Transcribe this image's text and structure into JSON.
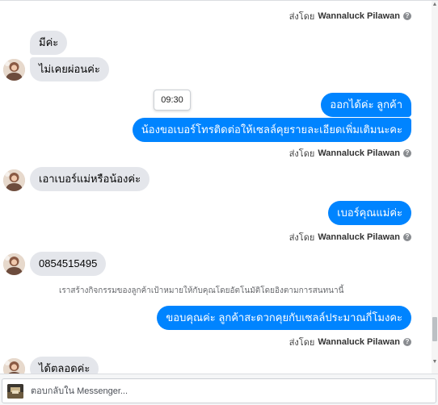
{
  "messages": {
    "sent_by_1": {
      "prefix": "ส่งโดย",
      "name": "Wannaluck Pilawan"
    },
    "in_1": "มีค่ะ",
    "in_2": "ไม่เคยผ่อนค่ะ",
    "timestamp_tooltip": "09:30",
    "out_1": "ออกได้ค่ะ  ลูกค้า",
    "out_2": "น้องขอเบอร์โทรติดต่อให้เซลล์คุยรายละเอียดเพิ่มเติมนะคะ",
    "sent_by_2": {
      "prefix": "ส่งโดย",
      "name": "Wannaluck Pilawan"
    },
    "in_3": "เอาเบอร์แม่หรือน้องค่ะ",
    "out_3": "เบอร์คุณแม่ค่ะ",
    "sent_by_3": {
      "prefix": "ส่งโดย",
      "name": "Wannaluck Pilawan"
    },
    "in_4": "0854515495",
    "notice": "เราสร้างกิจกรรมของลูกค้าเป้าหมายให้กับคุณโดยอัตโนมัติโดยอิงตามการสนทนานี้",
    "out_4": "ขอบคุณค่ะ ลูกค้าสะดวกคุยกับเซลล์ประมาณกี่โมงคะ",
    "sent_by_4": {
      "prefix": "ส่งโดย",
      "name": "Wannaluck Pilawan"
    },
    "in_5": "ได้ตลอดค่ะ"
  },
  "reply": {
    "placeholder": "ตอบกลับใน Messenger..."
  },
  "colors": {
    "outgoing": "#0084ff",
    "incoming": "#e4e6eb"
  },
  "icons": {
    "help": "question-circle-icon",
    "scroll_up": "triangle-up-icon",
    "scroll_down": "triangle-down-icon"
  }
}
